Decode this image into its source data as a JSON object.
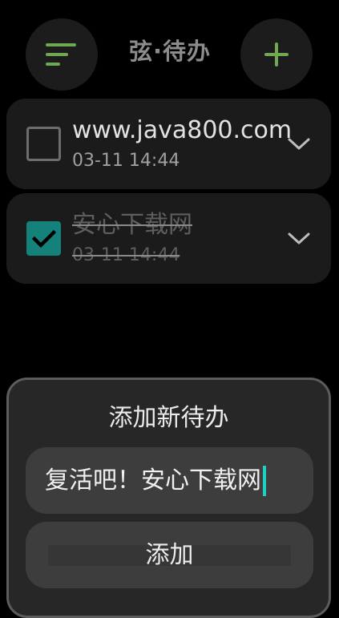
{
  "header": {
    "title": "弦·待办",
    "menu_icon": "sort-lines-icon",
    "add_icon": "plus-icon",
    "accent_color": "#6fa851"
  },
  "todos": [
    {
      "title": "www.java800.com",
      "time": "03-11 14:44",
      "done": false,
      "expand_icon": "chevron-down-icon"
    },
    {
      "title": "安心下载网",
      "time": "03-11 14:44",
      "done": true,
      "expand_icon": "chevron-down-icon"
    }
  ],
  "add_sheet": {
    "title": "添加新待办",
    "input_value": "复活吧！安心下载网",
    "submit_label": "添加",
    "caret_color": "#1fd1c3"
  },
  "colors": {
    "checked": "#14827b",
    "card": "#1b1b1b",
    "sheet": "#272727"
  }
}
